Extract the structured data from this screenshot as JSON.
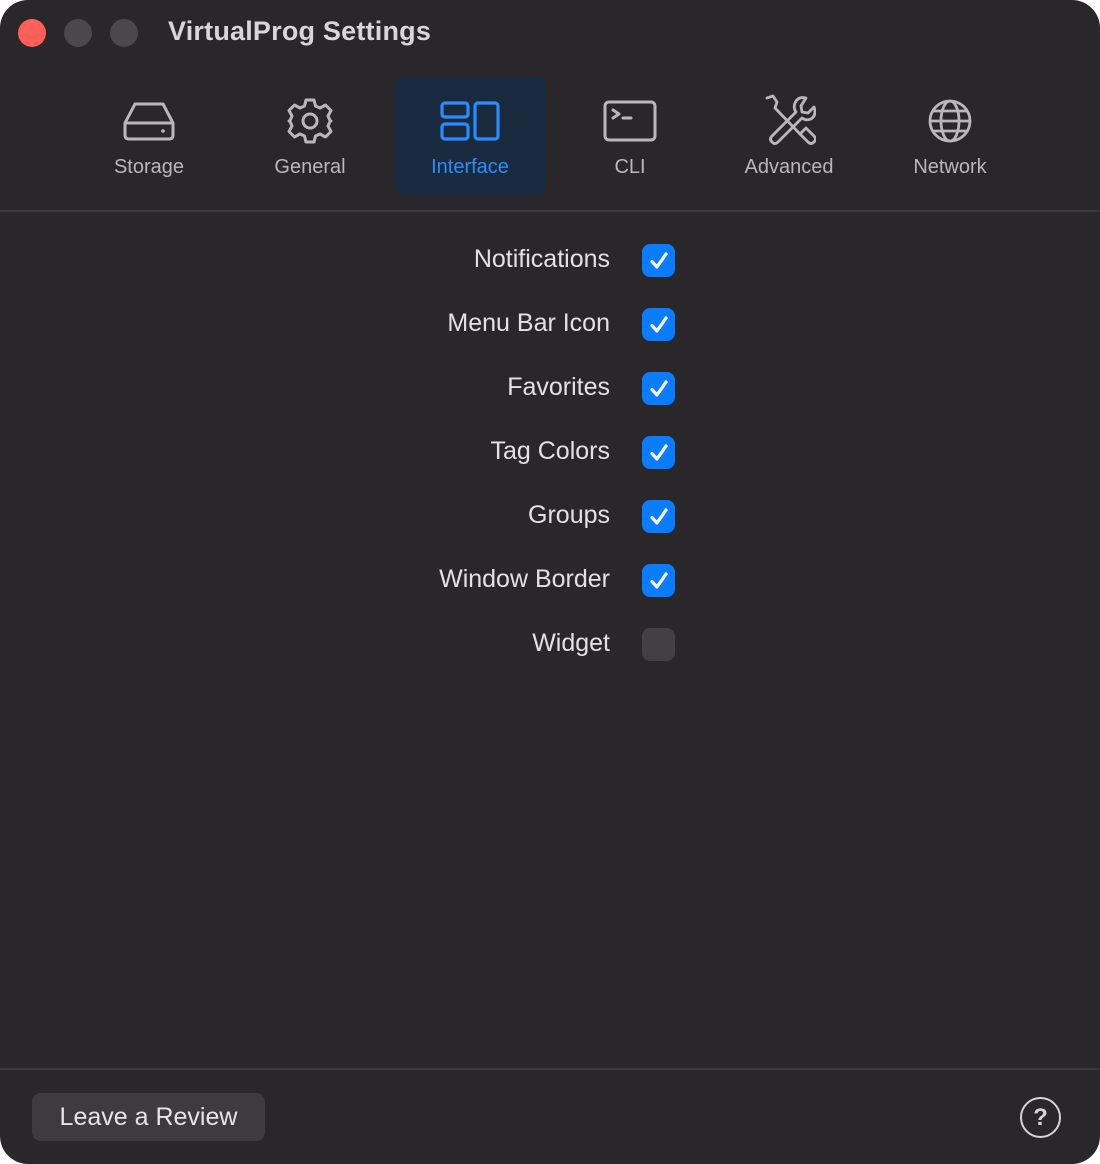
{
  "window": {
    "title": "VirtualProg Settings"
  },
  "tabs": [
    {
      "label": "Storage",
      "icon": "storage-drive-icon",
      "active": false
    },
    {
      "label": "General",
      "icon": "gear-icon",
      "active": false
    },
    {
      "label": "Interface",
      "icon": "interface-layout-icon",
      "active": true
    },
    {
      "label": "CLI",
      "icon": "terminal-icon",
      "active": false
    },
    {
      "label": "Advanced",
      "icon": "tools-icon",
      "active": false
    },
    {
      "label": "Network",
      "icon": "globe-icon",
      "active": false
    }
  ],
  "options": [
    {
      "label": "Notifications",
      "checked": true
    },
    {
      "label": "Menu Bar Icon",
      "checked": true
    },
    {
      "label": "Favorites",
      "checked": true
    },
    {
      "label": "Tag Colors",
      "checked": true
    },
    {
      "label": "Groups",
      "checked": true
    },
    {
      "label": "Window Border",
      "checked": true
    },
    {
      "label": "Widget",
      "checked": false
    }
  ],
  "footer": {
    "review_label": "Leave a Review",
    "help_symbol": "?"
  },
  "colors": {
    "accent": "#0a7cff",
    "active_tab_text": "#2b8cff",
    "active_tab_bg": "#1b2b3f",
    "window_bg": "#29272a",
    "close_light": "#fe5f57"
  }
}
